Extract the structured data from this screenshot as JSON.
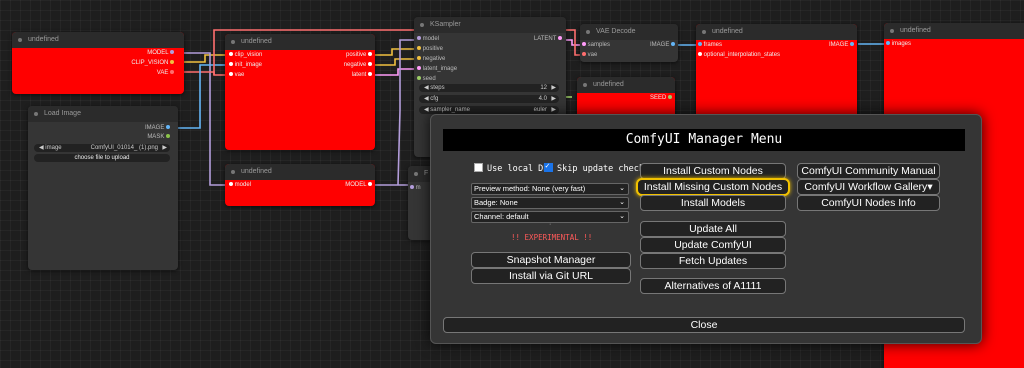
{
  "graph": {
    "wire_colors": {
      "clip": "#f0c040",
      "model": "#b39ddb",
      "image": "#64b5f6",
      "latent": "#ff9cf9",
      "vae": "#ff6e6e"
    },
    "nodes": {
      "loader": {
        "title": "undefined",
        "outputs": [
          "MODEL",
          "CLIP_VISION",
          "VAE"
        ]
      },
      "load_image": {
        "title": "Load Image",
        "outputs": [
          "IMAGE",
          "MASK"
        ],
        "image_widget_label": "image",
        "image_widget_value": "ComfyUI_01014_ (1).png",
        "upload_label": "choose file to upload"
      },
      "conditioning": {
        "title": "undefined",
        "inputs": [
          "clip_vision",
          "init_image",
          "vae"
        ],
        "outputs": [
          "positive",
          "negative",
          "latent"
        ]
      },
      "model_node": {
        "title": "undefined",
        "inputs": [
          "model"
        ],
        "outputs": [
          "MODEL"
        ]
      },
      "ksampler": {
        "title": "KSampler",
        "inputs": [
          "model",
          "positive",
          "negative",
          "latent_image",
          "seed"
        ],
        "outputs": [
          "LATENT"
        ],
        "widgets": [
          {
            "label": "steps",
            "value": "12"
          },
          {
            "label": "cfg",
            "value": "4.0"
          },
          {
            "label": "sampler_name",
            "value": "euler"
          }
        ]
      },
      "vae_decode": {
        "title": "VAE Decode",
        "inputs": [
          "samples",
          "vae"
        ],
        "outputs": [
          "IMAGE"
        ]
      },
      "seed_node": {
        "title": "undefined",
        "outputs": [
          "SEED"
        ]
      },
      "video_combine": {
        "title": "undefined",
        "inputs": [
          "frames",
          "optional_interpolation_states"
        ],
        "outputs": [
          "IMAGE"
        ]
      },
      "preview": {
        "title": "undefined",
        "inputs": [
          "images"
        ]
      },
      "partial_node": {
        "title": "F",
        "inputs": [
          "m"
        ]
      }
    }
  },
  "manager": {
    "title": "ComfyUI Manager Menu",
    "use_local_db": {
      "label": "Use local DB",
      "checked": false
    },
    "skip_update_check": {
      "label": "Skip update check",
      "checked": true
    },
    "preview_method": "Preview method: None (very fast)",
    "badge": "Badge: None",
    "channel": "Channel: default",
    "small_dot": "·",
    "experimental": "!! EXPERIMENTAL !!",
    "snapshot_manager": "Snapshot Manager",
    "install_git": "Install via Git URL",
    "install_custom": "Install Custom Nodes",
    "install_missing": "Install Missing Custom Nodes",
    "install_models": "Install Models",
    "update_all": "Update All",
    "update_comfyui": "Update ComfyUI",
    "fetch_updates": "Fetch Updates",
    "alternatives": "Alternatives of A1111",
    "community_manual": "ComfyUI Community Manual",
    "workflow_gallery": "ComfyUI Workflow Gallery",
    "workflow_gallery_arrow": "▾",
    "nodes_info": "ComfyUI Nodes Info",
    "close": "Close",
    "highlight_color": "#f2c200"
  }
}
